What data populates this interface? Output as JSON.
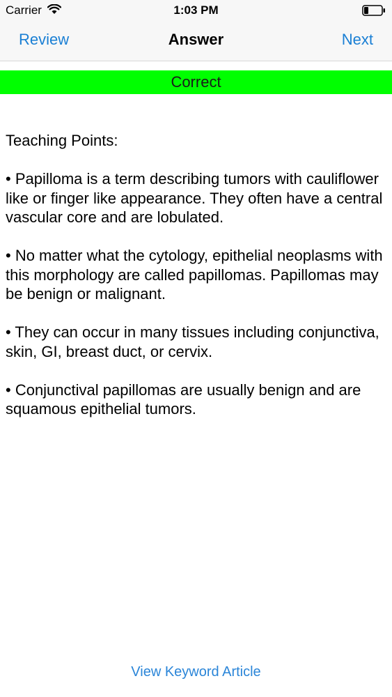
{
  "status_bar": {
    "carrier": "Carrier",
    "time": "1:03 PM",
    "wifi_icon": "wifi-icon",
    "battery_icon": "battery-icon"
  },
  "nav": {
    "left_label": "Review",
    "title": "Answer",
    "right_label": "Next",
    "link_color": "#1a7fd4"
  },
  "result": {
    "label": "Correct",
    "color": "#00ff00"
  },
  "teaching": {
    "heading": "Teaching Points:",
    "points": [
      "• Papilloma is a term describing tumors with cauliflower like or finger like appearance. They often have a central vascular core and are lobulated.",
      "• No matter what the cytology, epithelial neoplasms with this morphology are called papillomas. Papillomas may be benign or malignant.",
      "• They can occur in many tissues including conjunctiva, skin, GI, breast duct, or cervix.",
      "•  Conjunctival papillomas are usually benign and are squamous epithelial tumors."
    ]
  },
  "footer": {
    "link_label": "View Keyword Article"
  }
}
